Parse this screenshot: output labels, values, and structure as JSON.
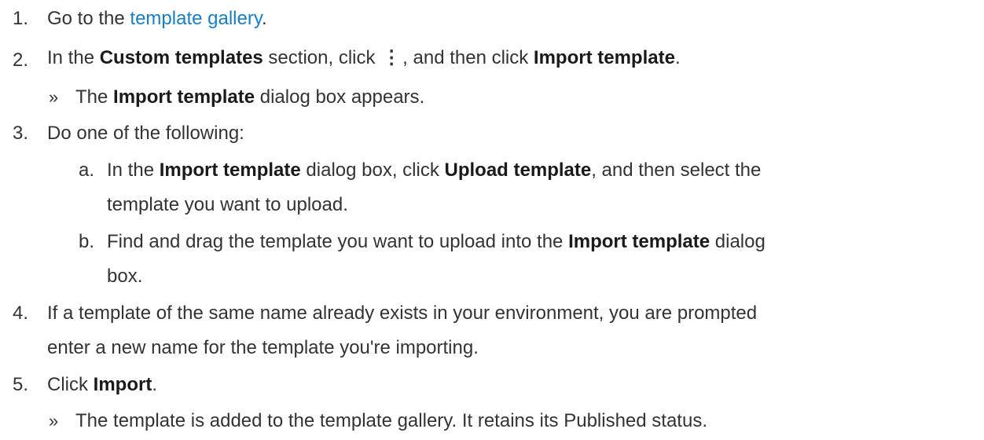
{
  "steps": {
    "s1": {
      "num": "1.",
      "pre": "Go to the ",
      "link": "template gallery",
      "post": "."
    },
    "s2": {
      "num": "2.",
      "pre": "In the ",
      "b1": "Custom templates",
      "mid": " section, click ",
      "icon": "⋮",
      "mid2": ", and then click ",
      "b2": "Import template",
      "post": ".",
      "result": {
        "marker": "»",
        "pre": "The ",
        "b": "Import template",
        "post": " dialog box appears."
      }
    },
    "s3": {
      "num": "3.",
      "text": "Do one of the following:",
      "a": {
        "num": "a.",
        "pre": "In the ",
        "b1": "Import template",
        "mid": " dialog box, click ",
        "b2": "Upload template",
        "post": ", and then select the",
        "cont": "template you want to upload."
      },
      "b": {
        "num": "b.",
        "pre": "Find and drag the template you want to upload into the ",
        "b1": "Import template",
        "post": " dialog",
        "cont": "box."
      }
    },
    "s4": {
      "num": "4.",
      "line1": "If a template of the same name already exists in your environment, you are prompted",
      "line2": "enter a new name for the template you're importing."
    },
    "s5": {
      "num": "5.",
      "pre": "Click ",
      "b": "Import",
      "post": ".",
      "result": {
        "marker": "»",
        "text": "The template is added to the template gallery. It retains its Published status."
      }
    }
  },
  "icons": {
    "more_options": "vertical-ellipsis-icon"
  },
  "colors": {
    "text": "#333333",
    "bold": "#1a1a1a",
    "link": "#1a7fc1"
  }
}
